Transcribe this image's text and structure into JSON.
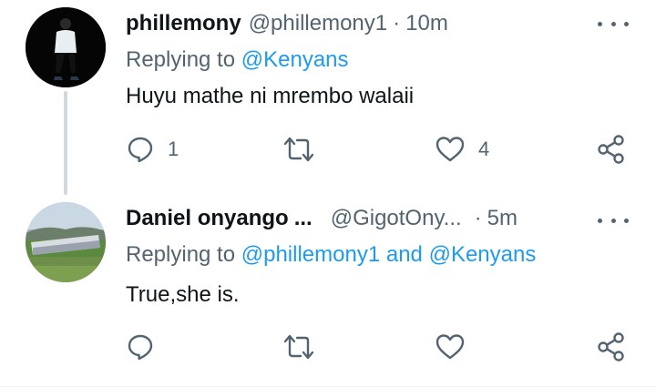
{
  "tweets": [
    {
      "display_name": "phillemony",
      "handle": "@phillemony1",
      "separator": "·",
      "time": "10m",
      "replying_prefix": "Replying to",
      "replying_to": [
        "@Kenyans"
      ],
      "replying_joiner": "",
      "text": "Huyu mathe ni mrembo walaii",
      "reply_count": "1",
      "retweet_count": "",
      "like_count": "4",
      "avatar": "person-photo"
    },
    {
      "display_name": "Daniel onyango",
      "ellipsis": "...",
      "handle": "@GigotOny...",
      "separator": "·",
      "time": "5m",
      "replying_prefix": "Replying to",
      "replying_to": [
        "@phillemony1",
        "@Kenyans"
      ],
      "replying_joiner": "and",
      "text": "True,she is.",
      "reply_count": "",
      "retweet_count": "",
      "like_count": "",
      "avatar": "landscape-photo"
    }
  ],
  "icons": {
    "more": "more-dots-icon",
    "reply": "reply-bubble-icon",
    "retweet": "retweet-icon",
    "like": "heart-icon",
    "share": "share-icon"
  },
  "colors": {
    "text": "#0f1419",
    "secondary": "#536471",
    "link": "#1d9bf0",
    "thread_line": "#cfd9de"
  }
}
